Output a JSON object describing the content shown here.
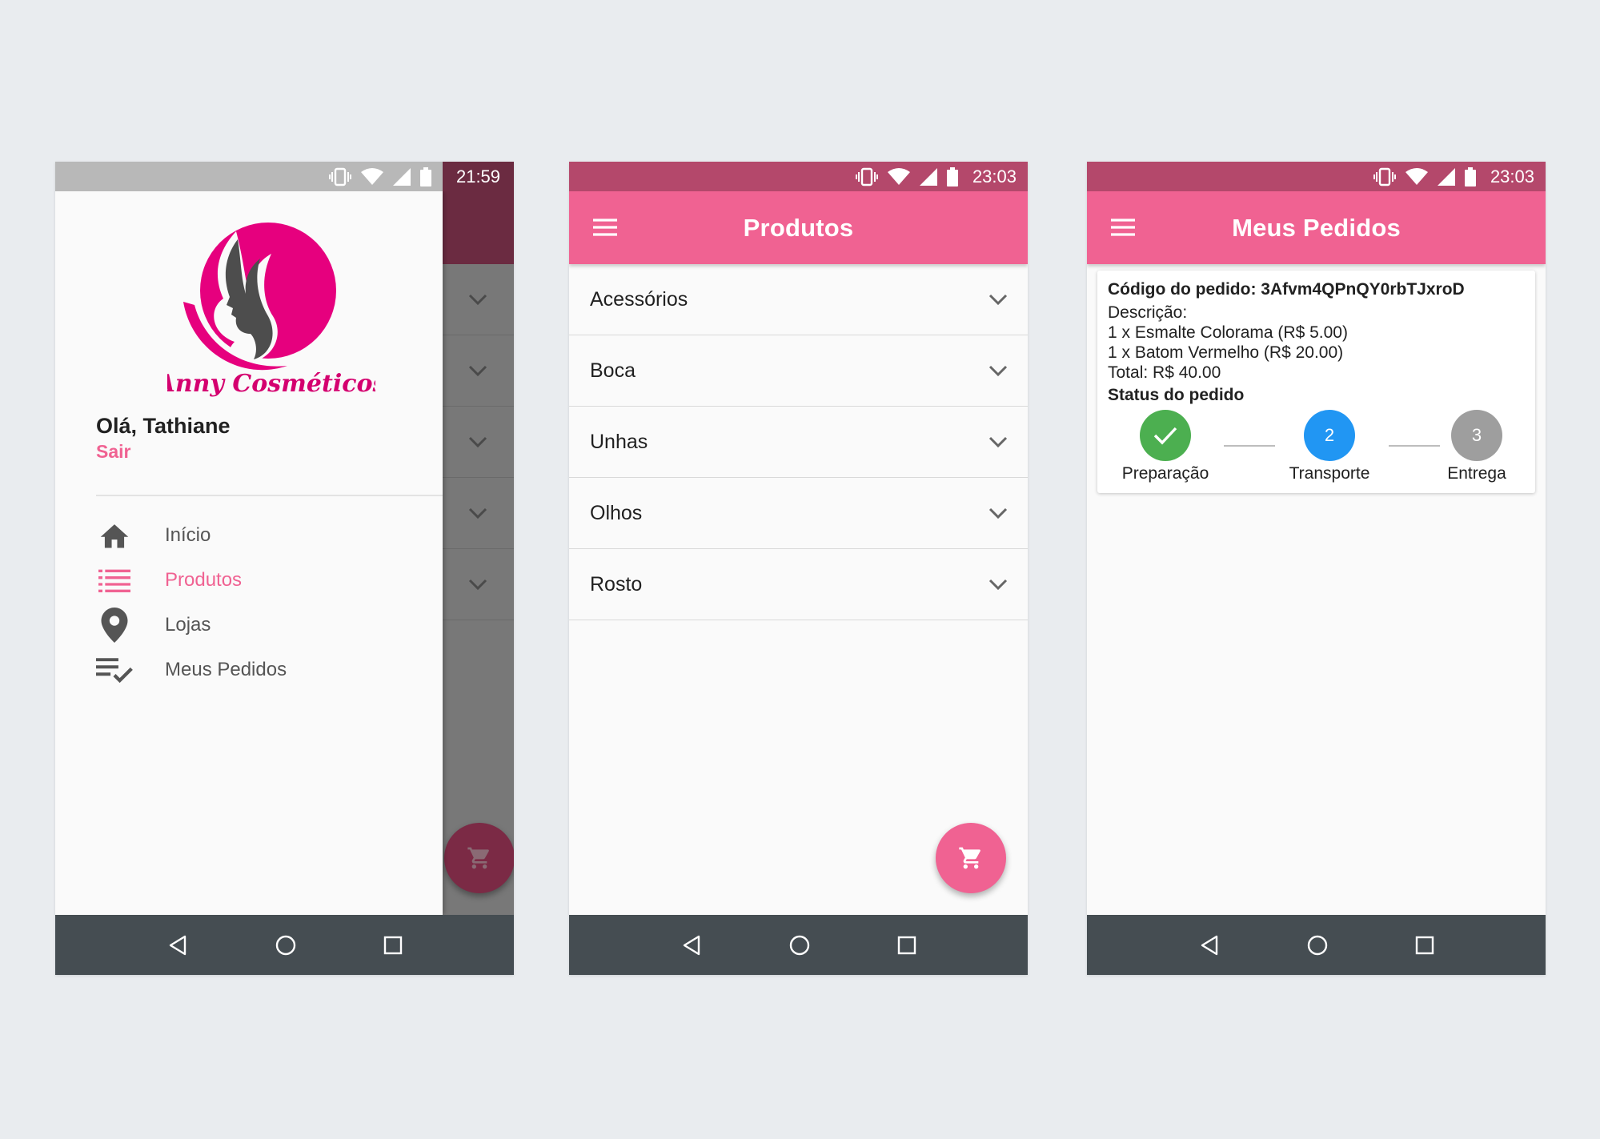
{
  "colors": {
    "primary": "#f06292",
    "statusbar": "#b4486b",
    "success": "#4caf50",
    "active": "#2196f3",
    "inactive": "#9e9e9e",
    "navbar": "#454d52"
  },
  "screen1": {
    "time": "21:59",
    "logo": {
      "brand_text": "Anny Cosméticos"
    },
    "greeting": "Olá, Tathiane",
    "logout": "Sair",
    "menu": [
      {
        "label": "Início",
        "icon": "home-icon"
      },
      {
        "label": "Produtos",
        "icon": "list-icon",
        "active": true
      },
      {
        "label": "Lojas",
        "icon": "location-pin-icon"
      },
      {
        "label": "Meus Pedidos",
        "icon": "playlist-check-icon"
      }
    ]
  },
  "screen2": {
    "time": "23:03",
    "title": "Produtos",
    "categories": [
      "Acessórios",
      "Boca",
      "Unhas",
      "Olhos",
      "Rosto"
    ]
  },
  "screen3": {
    "time": "23:03",
    "title": "Meus Pedidos",
    "order": {
      "code": "Código do pedido: 3Afvm4QPnQY0rbTJxroD",
      "description_label": "Descrição:",
      "items": [
        "1 x Esmalte Colorama (R$ 5.00)",
        "1 x Batom Vermelho (R$ 20.00)"
      ],
      "total": "Total: R$ 40.00",
      "status_title": "Status do pedido",
      "steps": [
        {
          "label": "Preparação",
          "number": "",
          "state": "done"
        },
        {
          "label": "Transporte",
          "number": "2",
          "state": "active"
        },
        {
          "label": "Entrega",
          "number": "3",
          "state": "pending"
        }
      ]
    }
  }
}
